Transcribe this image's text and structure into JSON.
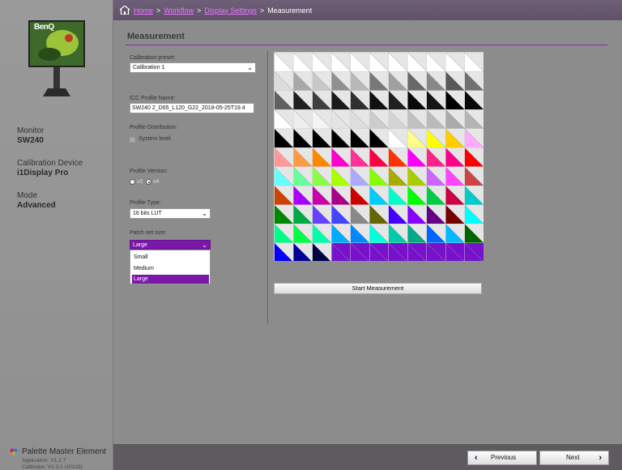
{
  "breadcrumb": {
    "home": "Home",
    "workflow": "Workflow",
    "display_settings": "Display Settings",
    "current": "Measurement",
    "separator": ">"
  },
  "sidebar": {
    "logo_text": "BenQ",
    "monitor_label": "Monitor",
    "monitor_value": "SW240",
    "device_label": "Calibration Device",
    "device_value": "i1Display Pro",
    "mode_label": "Mode",
    "mode_value": "Advanced",
    "app_name": "Palette Master Element",
    "app_version": "Application: V1.2.7",
    "calibrator_version": "Calibrator: V1.3.1 (10133)"
  },
  "main": {
    "title": "Measurement",
    "calibration_preset_label": "Calibration preset:",
    "calibration_preset_value": "Calibration 1",
    "icc_label": "ICC Profile Name:",
    "icc_value": "SW240 2_D65_L120_G22_2018-05-25T19.4",
    "distribution_label": "Profile Distribution:",
    "system_level_label": "System level",
    "version_label": "Profile Version:",
    "version_v2": "v2",
    "version_v4": "v4",
    "profile_type_label": "Profile Type:",
    "profile_type_value": "16 bits LUT",
    "patch_label": "Patch set size:",
    "patch_value": "Large",
    "patch_options": [
      "Small",
      "Medium",
      "Large"
    ],
    "start_button": "Start Measurement"
  },
  "footer": {
    "previous": "Previous",
    "next": "Next"
  },
  "patches": [
    [
      "#ffffff",
      "#ffffff",
      "#ffffff",
      "#ffffff",
      "#ffffff",
      "#ffffff",
      "#ffffff",
      "#ffffff",
      "#ffffff",
      "#ffffff",
      "#ffffff"
    ],
    [
      "#dcdcdc",
      "#a8a8a8",
      "#c8c8c8",
      "#909090",
      "#b8b8b8",
      "#787878",
      "#a0a0a0",
      "#686868",
      "#888888",
      "#585858",
      "#707070"
    ],
    [
      "#606060",
      "#202020",
      "#404040",
      "#1a1a1a",
      "#303030",
      "#101010",
      "#202020",
      "#080808",
      "#141414",
      "#000000",
      "#0a0a0a"
    ],
    [
      "#ffffff",
      "#eeeeee",
      "#f4f4f4",
      "#e4e4e4",
      "#dddddd",
      "#cccccc",
      "#d4d4d4",
      "#c0c0c0",
      "#bbbbbb",
      "#aaaaaa",
      "#b4b4b4"
    ],
    [
      "#000000",
      "#000000",
      "#000000",
      "#000000",
      "#000000",
      "#000000",
      "#ffffff",
      "#ffff88",
      "#ffff00",
      "#ffcc00",
      "#ffaaff"
    ],
    [
      "#ff9999",
      "#ff9944",
      "#ff8800",
      "#ff00cc",
      "#ff3399",
      "#ff0044",
      "#ff3300",
      "#ff00ff",
      "#ff2288",
      "#ff0088",
      "#ff0000"
    ],
    [
      "#66ffff",
      "#66ff99",
      "#88ff44",
      "#aaff00",
      "#aaaaff",
      "#88ff00",
      "#aaaa00",
      "#aacc00",
      "#cc66ff",
      "#ff44ff",
      "#cc4444"
    ],
    [
      "#cc4400",
      "#aa00ff",
      "#cc00aa",
      "#aa0088",
      "#cc0000",
      "#00ccff",
      "#00ffcc",
      "#00ff00",
      "#00cc44",
      "#cc0044",
      "#00cccc"
    ],
    [
      "#008800",
      "#00aa44",
      "#6644ff",
      "#4444ff",
      "#888888",
      "#666600",
      "#4400ff",
      "#8800ff",
      "#660088",
      "#770000",
      "#00ffff"
    ],
    [
      "#00ff88",
      "#00ff44",
      "#00ffaa",
      "#00aaff",
      "#0088ff",
      "#00ffdd",
      "#00ccaa",
      "#00aa88",
      "#0066ff",
      "#00bbff",
      "#006600"
    ],
    [
      "#0000ff",
      "#000099",
      "#000044",
      "#7711cc",
      "#7711cc",
      "#7711cc",
      "#7711cc",
      "#7711cc",
      "#7711cc",
      "#7711cc",
      "#7711cc"
    ]
  ]
}
